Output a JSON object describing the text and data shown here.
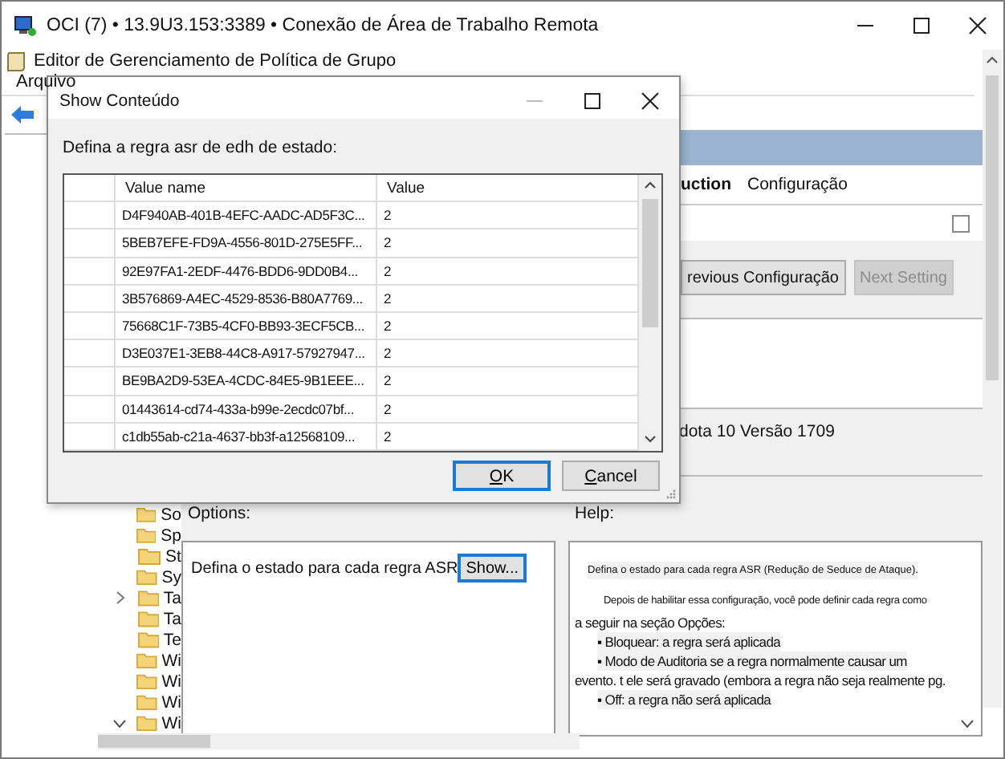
{
  "window": {
    "title": "OCI (7) • 13.9U3.153:3389 • Conexão de Área de Trabalho Remota"
  },
  "app": {
    "title": "Editor de Gerenciamento de Política de Grupo",
    "menu": [
      "Arquivo"
    ]
  },
  "policy": {
    "tabs": [
      {
        "label": "uction",
        "selected": true
      },
      {
        "label": "Configuração",
        "selected": false
      }
    ],
    "checkbox": {
      "checked": false
    },
    "buttons": [
      {
        "label": "revious Configuração",
        "disabled": false
      },
      {
        "label": "Next Setting",
        "disabled": true
      }
    ],
    "supported": "dota 10 Versão 1709",
    "options_label": "Options:",
    "help_label": "Help:",
    "option_text": "Defina o estado para cada regra ASR",
    "show_button": "Show...",
    "help": [
      {
        "kind": "small",
        "text": "Defina o estado para cada regra ASR (Redução de Seduce de Ataque)."
      },
      {
        "kind": "small-indent",
        "text": "Depois de habilitar essa configuração, você pode definir cada regra como"
      },
      {
        "kind": "line",
        "text": "a seguir na seção Opções:"
      },
      {
        "kind": "bullet",
        "text": "▪ Bloquear: a regra será aplicada"
      },
      {
        "kind": "bullet",
        "text": "▪ Modo de Auditoria se a regra normalmente causar um"
      },
      {
        "kind": "line",
        "text": "evento. t ele será gravado (embora a regra não seja realmente pg."
      },
      {
        "kind": "bullet",
        "text": "▪ Off: a regra não será aplicada"
      }
    ]
  },
  "tree": [
    {
      "label": "So",
      "kind": "leaf"
    },
    {
      "label": "Sp",
      "kind": "leaf"
    },
    {
      "label": "St",
      "kind": "leaf"
    },
    {
      "label": "Sy",
      "kind": "leaf"
    },
    {
      "label": "Ta",
      "kind": "collapsed"
    },
    {
      "label": "Ta",
      "kind": "leaf"
    },
    {
      "label": "Te",
      "kind": "leaf"
    },
    {
      "label": "Wi",
      "kind": "leaf"
    },
    {
      "label": "Wi",
      "kind": "leaf"
    },
    {
      "label": "Wi",
      "kind": "leaf"
    },
    {
      "label": "Wi",
      "kind": "expanded"
    }
  ],
  "dialog": {
    "title": "Show Conteúdo",
    "prompt": "Defina a regra asr de edh de estado:",
    "columns": [
      "Value name",
      "Value"
    ],
    "rows": [
      {
        "name": "D4F940AB-401B-4EFC-AADC-AD5F3C...",
        "value": "2"
      },
      {
        "name": "5BEB7EFE-FD9A-4556-801D-275E5FF...",
        "value": "2"
      },
      {
        "name": "92E97FA1-2EDF-4476-BDD6-9DD0B4...",
        "value": "2"
      },
      {
        "name": "3B576869-A4EC-4529-8536-B80A7769...",
        "value": "2"
      },
      {
        "name": "75668C1F-73B5-4CF0-BB93-3ECF5CB...",
        "value": "2"
      },
      {
        "name": "D3E037E1-3EB8-44C8-A917-57927947...",
        "value": "2"
      },
      {
        "name": "BE9BA2D9-53EA-4CDC-84E5-9B1EEE...",
        "value": "2"
      },
      {
        "name": "01443614-cd74-433a-b99e-2ecdc07bf...",
        "value": "2"
      },
      {
        "name": "c1db55ab-c21a-4637-bb3f-a12568109...",
        "value": "2"
      }
    ],
    "buttons": [
      {
        "label": "OK",
        "default": true
      },
      {
        "label": "Cancel",
        "default": false
      }
    ]
  }
}
